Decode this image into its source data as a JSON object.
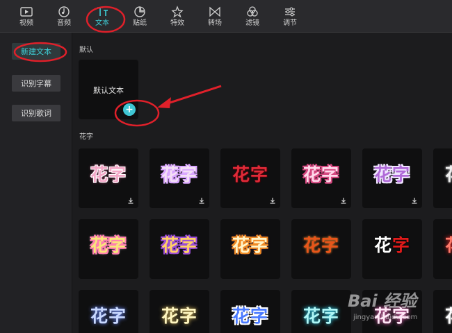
{
  "toolbar": {
    "tabs": [
      {
        "label": "视频",
        "icon": "video-icon"
      },
      {
        "label": "音频",
        "icon": "audio-icon"
      },
      {
        "label": "文本",
        "icon": "text-icon",
        "active": true
      },
      {
        "label": "贴纸",
        "icon": "sticker-icon"
      },
      {
        "label": "特效",
        "icon": "effects-icon"
      },
      {
        "label": "转场",
        "icon": "transition-icon"
      },
      {
        "label": "滤镜",
        "icon": "filter-icon"
      },
      {
        "label": "调节",
        "icon": "adjust-icon"
      }
    ]
  },
  "sidebar": {
    "items": [
      "新建文本",
      "识别字幕",
      "识别歌词"
    ],
    "active_index": 0
  },
  "default_section": {
    "title": "默认",
    "card_label": "默认文本"
  },
  "flower_section": {
    "title": "花字",
    "card_text": "花字"
  },
  "colors": {
    "accent": "#3fd0d8",
    "annotation": "#e0202a"
  },
  "watermark": {
    "line1": "Bai 经验",
    "line2": "jingyan.baidu.com"
  }
}
